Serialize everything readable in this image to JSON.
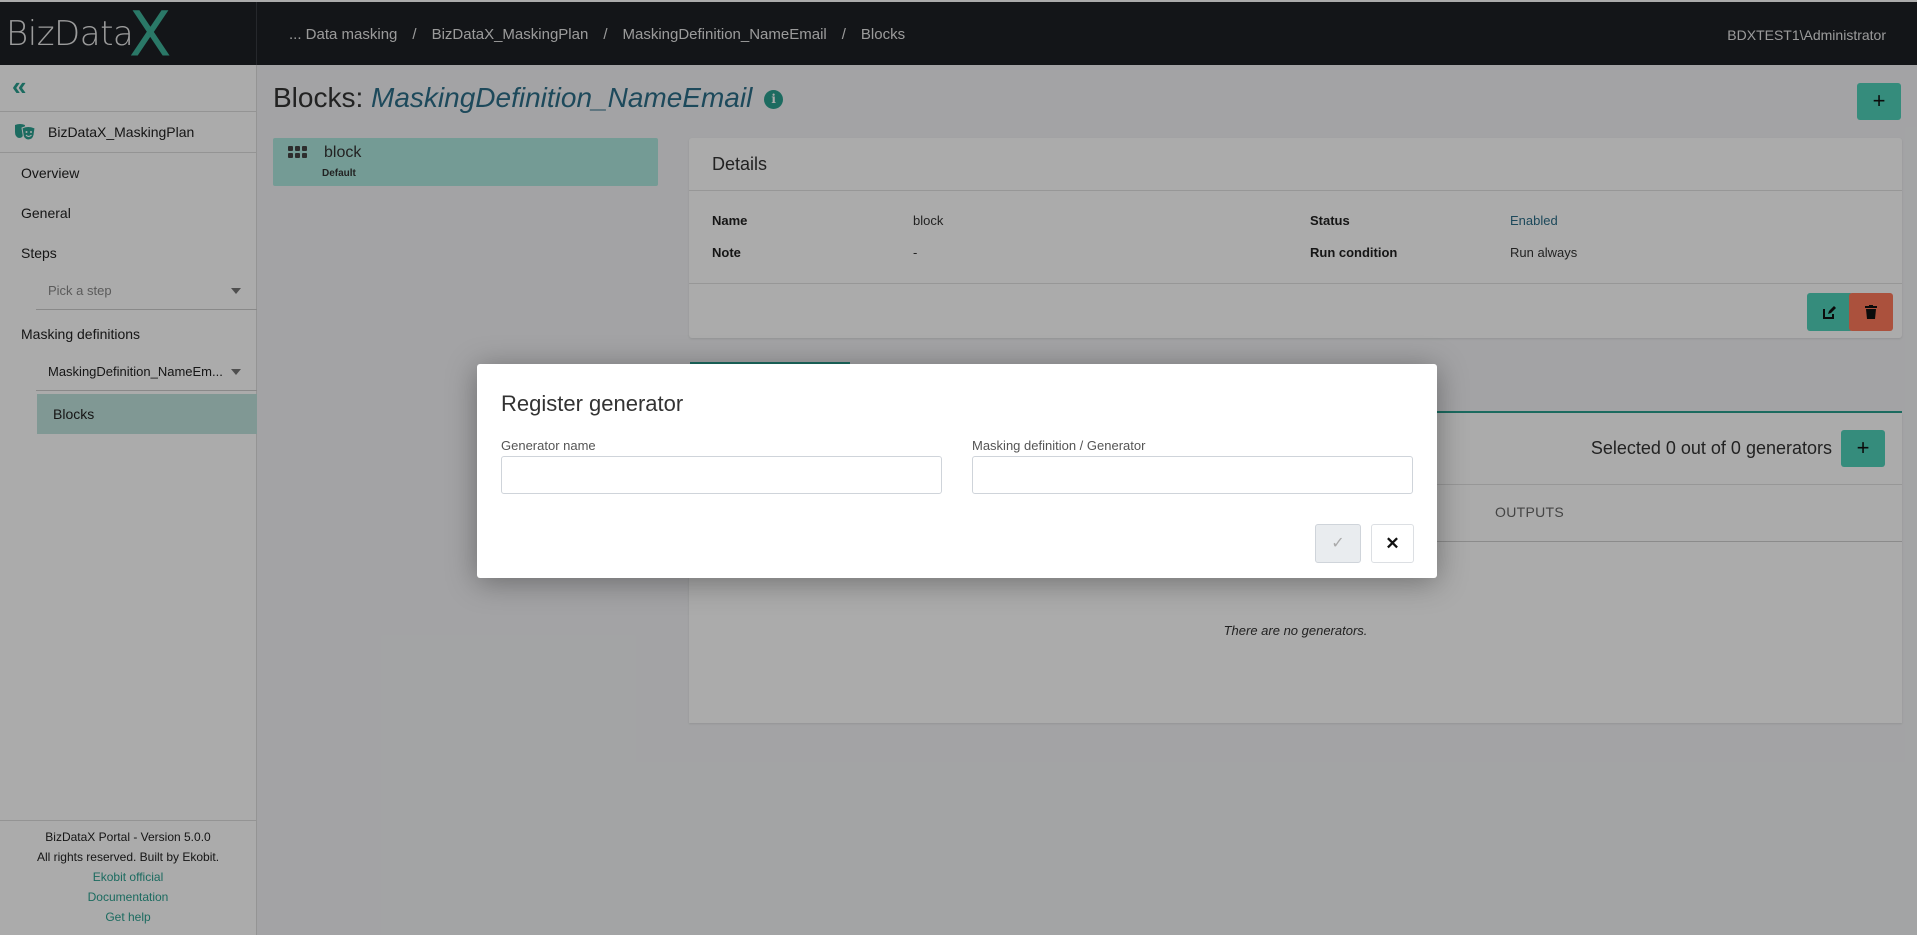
{
  "app": {
    "logo_text": "BizData",
    "logo_x": "X",
    "user": "BDXTEST1\\Administrator"
  },
  "breadcrumb": [
    {
      "label": "... Data masking"
    },
    {
      "label": "BizDataX_MaskingPlan"
    },
    {
      "label": "MaskingDefinition_NameEmail"
    },
    {
      "label": "Blocks"
    }
  ],
  "breadcrumb_separator": "/",
  "sidebar": {
    "collapse_icon": "«",
    "plan_name": "BizDataX_MaskingPlan",
    "items": [
      {
        "label": "Overview"
      },
      {
        "label": "General"
      },
      {
        "label": "Steps"
      }
    ],
    "step_select": {
      "placeholder": "Pick a step"
    },
    "masking_definitions_label": "Masking definitions",
    "definition_select": {
      "value": "MaskingDefinition_NameEm..."
    },
    "active_item": "Blocks",
    "footer": {
      "version": "BizDataX Portal - Version 5.0.0",
      "rights": "All rights reserved. Built by Ekobit.",
      "links": [
        "Ekobit official",
        "Documentation",
        "Get help"
      ]
    }
  },
  "page": {
    "title_prefix": "Blocks:",
    "title_name": "MaskingDefinition_NameEmail",
    "info_icon": "i",
    "add_label": "+"
  },
  "blocks": [
    {
      "name": "block",
      "tag": "Default"
    }
  ],
  "details": {
    "heading": "Details",
    "fields": [
      {
        "key": "Name",
        "value": "block"
      },
      {
        "key": "Note",
        "value": "-"
      },
      {
        "key": "Status",
        "value": "Enabled"
      },
      {
        "key": "Run condition",
        "value": "Run always"
      }
    ],
    "status_color": "#2c6e88"
  },
  "generators": {
    "count_text": "Selected 0 out of 0 generators",
    "add_label": "+",
    "columns": [
      "OUTPUTS"
    ],
    "empty_text": "There are no generators."
  },
  "modal": {
    "title": "Register generator",
    "fields": [
      {
        "label": "Generator name",
        "value": "",
        "placeholder": ""
      },
      {
        "label": "Masking definition / Generator",
        "value": "",
        "placeholder": ""
      }
    ],
    "confirm_icon": "✓",
    "cancel_icon": "✕"
  },
  "colors": {
    "accent": "#4fd1b9",
    "accent_dark": "#2aa08f",
    "danger": "#ff7a5c",
    "topbar": "#1d2025"
  }
}
